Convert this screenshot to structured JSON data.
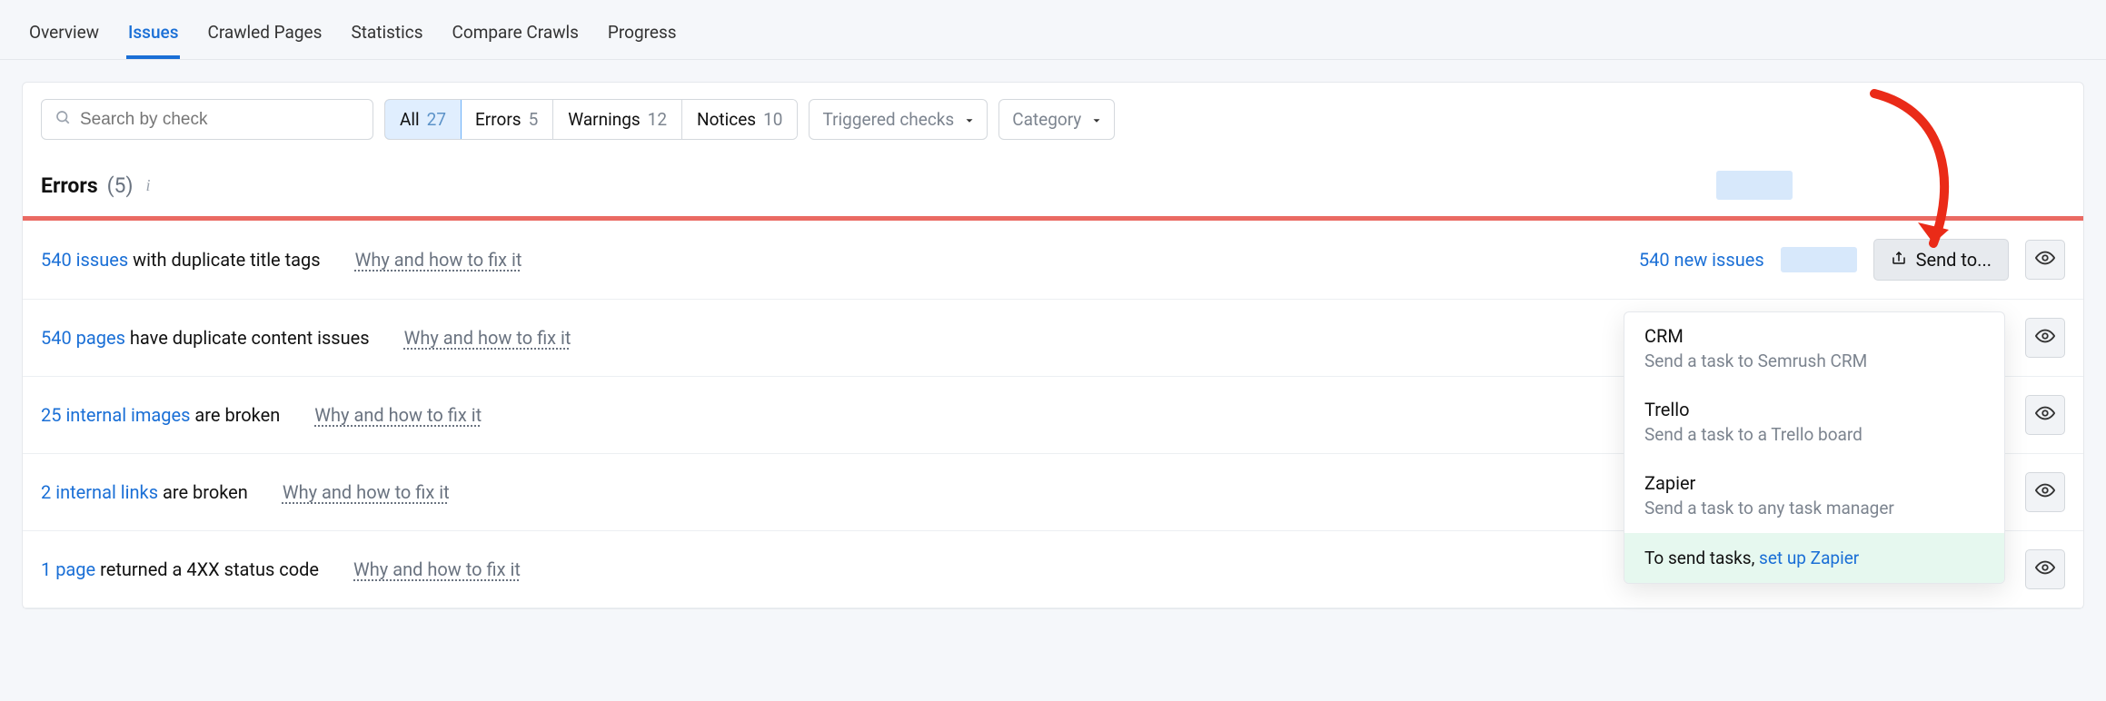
{
  "nav": {
    "items": [
      "Overview",
      "Issues",
      "Crawled Pages",
      "Statistics",
      "Compare Crawls",
      "Progress"
    ],
    "active_index": 1
  },
  "toolbar": {
    "search_placeholder": "Search by check",
    "filters": [
      {
        "label": "All",
        "count": "27",
        "active": true
      },
      {
        "label": "Errors",
        "count": "5",
        "active": false
      },
      {
        "label": "Warnings",
        "count": "12",
        "active": false
      },
      {
        "label": "Notices",
        "count": "10",
        "active": false
      }
    ],
    "triggered_label": "Triggered checks",
    "category_label": "Category"
  },
  "section": {
    "title": "Errors",
    "count_text": "(5)"
  },
  "rows": [
    {
      "link_text": "540 issues",
      "rest_text": " with duplicate title tags",
      "fix": "Why and how to fix it",
      "new_issues": "540 new issues",
      "show_send": true
    },
    {
      "link_text": "540 pages",
      "rest_text": " have duplicate content issues",
      "fix": "Why and how to fix it",
      "new_issues": "",
      "show_send": false
    },
    {
      "link_text": "25 internal images",
      "rest_text": " are broken",
      "fix": "Why and how to fix it",
      "new_issues": "",
      "show_send": false
    },
    {
      "link_text": "2 internal links",
      "rest_text": " are broken",
      "fix": "Why and how to fix it",
      "new_issues": "",
      "show_send": false
    },
    {
      "link_text": "1 page",
      "rest_text": " returned a 4XX status code",
      "fix": "Why and how to fix it",
      "new_issues": "",
      "show_send": false
    }
  ],
  "send_button_label": "Send to...",
  "popup": {
    "items": [
      {
        "title": "CRM",
        "sub": "Send a task to Semrush CRM"
      },
      {
        "title": "Trello",
        "sub": "Send a task to a Trello board"
      },
      {
        "title": "Zapier",
        "sub": "Send a task to any task manager"
      }
    ],
    "footer_prefix": "To send tasks, ",
    "footer_link": "set up Zapier"
  }
}
